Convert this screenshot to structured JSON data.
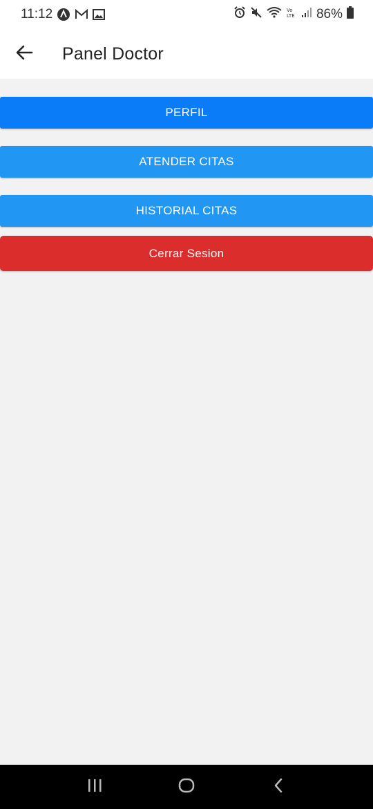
{
  "status_bar": {
    "time": "11:12",
    "battery": "86%",
    "left_icons": [
      "app-a-icon",
      "gmail-icon",
      "gallery-icon"
    ],
    "right_icons": [
      "alarm-icon",
      "mute-icon",
      "wifi-icon",
      "volte-icon",
      "signal-icon",
      "battery-icon"
    ]
  },
  "app_bar": {
    "title": "Panel Doctor",
    "back_icon": "arrow-left-icon"
  },
  "buttons": {
    "perfil": "PERFIL",
    "atender": "ATENDER CITAS",
    "historial": "HISTORIAL CITAS",
    "cerrar": "Cerrar Sesion"
  },
  "colors": {
    "primary": "#0a7cf7",
    "secondary": "#2196f3",
    "danger": "#dc2d2d",
    "background": "#f2f2f2"
  },
  "nav_bar": {
    "items": [
      "recent-apps-icon",
      "home-icon",
      "back-icon"
    ]
  }
}
